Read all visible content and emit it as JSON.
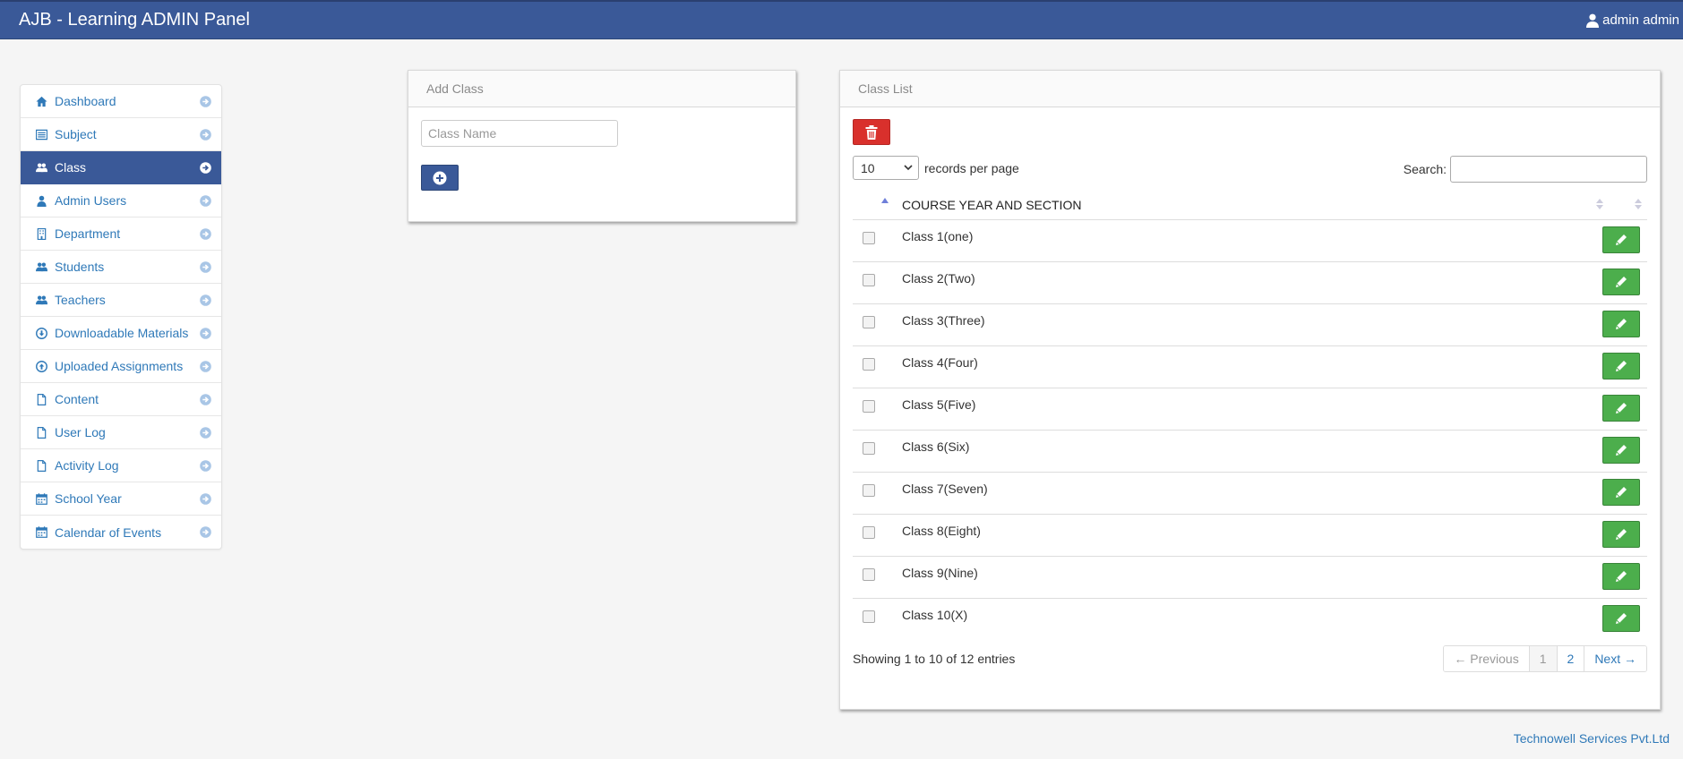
{
  "app": {
    "title": "AJB - Learning ADMIN Panel",
    "user": "admin admin"
  },
  "sidebar": {
    "items": [
      {
        "label": "Dashboard",
        "icon": "home-icon"
      },
      {
        "label": "Subject",
        "icon": "list-icon"
      },
      {
        "label": "Class",
        "icon": "users-icon",
        "active": true
      },
      {
        "label": "Admin Users",
        "icon": "user-icon"
      },
      {
        "label": "Department",
        "icon": "building-icon"
      },
      {
        "label": "Students",
        "icon": "users-icon"
      },
      {
        "label": "Teachers",
        "icon": "users-icon"
      },
      {
        "label": "Downloadable Materials",
        "icon": "download-icon"
      },
      {
        "label": "Uploaded Assignments",
        "icon": "upload-icon"
      },
      {
        "label": "Content",
        "icon": "file-icon"
      },
      {
        "label": "User Log",
        "icon": "file-icon"
      },
      {
        "label": "Activity Log",
        "icon": "file-icon"
      },
      {
        "label": "School Year",
        "icon": "calendar-icon"
      },
      {
        "label": "Calendar of Events",
        "icon": "calendar-icon"
      }
    ]
  },
  "add_class": {
    "title": "Add Class",
    "placeholder": "Class Name"
  },
  "class_list": {
    "title": "Class List",
    "per_page_value": "10",
    "per_page_label": "records per page",
    "search_label": "Search:",
    "column_header": "COURSE YEAR AND SECTION",
    "rows": [
      "Class 1(one)",
      "Class 2(Two)",
      "Class 3(Three)",
      "Class 4(Four)",
      "Class 5(Five)",
      "Class 6(Six)",
      "Class 7(Seven)",
      "Class 8(Eight)",
      "Class 9(Nine)",
      "Class 10(X)"
    ],
    "info": "Showing 1 to 10 of 12 entries",
    "pagination": {
      "previous": "← Previous",
      "pages": [
        "1",
        "2"
      ],
      "next": "Next →"
    }
  },
  "footer": {
    "text": "Technowell Services Pvt.Ltd"
  },
  "colors": {
    "navbar": "#3a5998",
    "link": "#2f79b8",
    "delete": "#d9302c",
    "edit": "#4cae4c"
  }
}
